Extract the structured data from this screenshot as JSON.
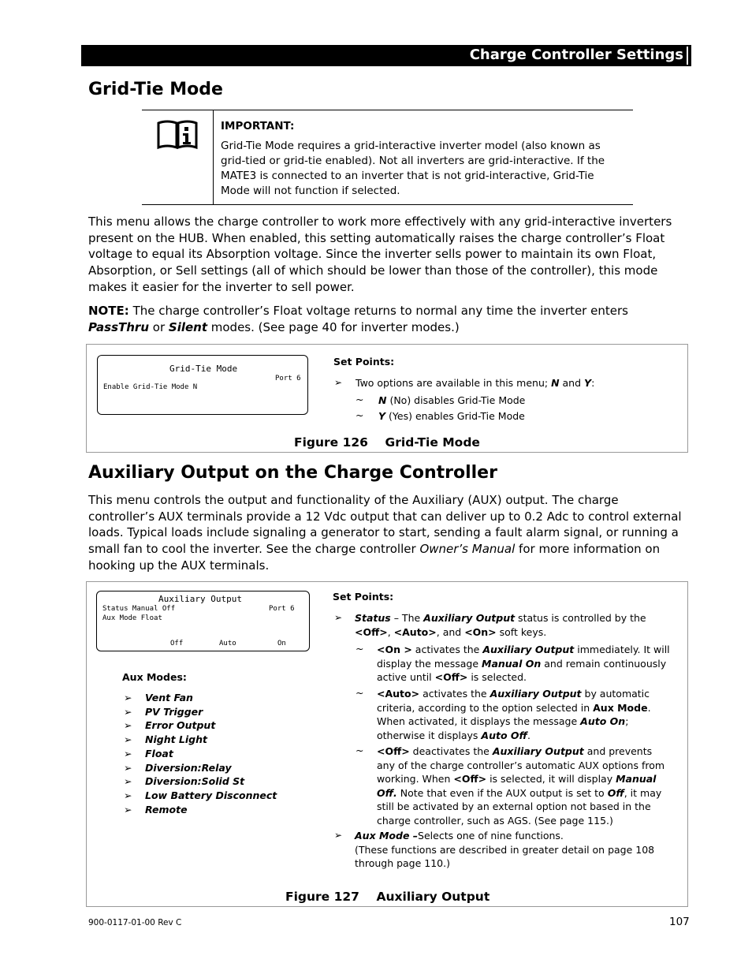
{
  "header": {
    "section_title": "Charge Controller Settings"
  },
  "gridtie": {
    "heading": "Grid-Tie Mode",
    "important": {
      "icon": "manual-info-icon",
      "title": "IMPORTANT:",
      "text": "Grid-Tie Mode requires a grid-interactive inverter model (also known as grid-tied or grid-tie enabled).  Not all inverters are grid-interactive.  If the MATE3 is connected to an inverter that is not grid-interactive, Grid-Tie Mode will not function if selected."
    },
    "body": "This menu allows the charge controller to work more effectively with any grid-interactive inverters present on the HUB.  When enabled, this setting automatically raises the charge controller’s Float voltage to equal its Absorption voltage.  Since the inverter sells power to maintain its own Float, Absorption, or Sell settings (all of which should be lower than those of the controller), this mode makes it easier for the inverter to sell power.",
    "note_label": "NOTE:",
    "note_text_1": " The charge controller’s Float voltage returns to normal any time the inverter enters ",
    "note_passthru": "PassThru",
    "note_text_2": " or ",
    "note_silent": "Silent",
    "note_text_3": " modes.  (See page 40 for inverter modes.)",
    "lcd": {
      "title": "Grid-Tie Mode",
      "port": "Port 6",
      "line1": "Enable Grid-Tie Mode N"
    },
    "setpoints": {
      "title": "Set Points:",
      "intro_1": "Two options are available in this menu; ",
      "intro_n": "N",
      "intro_2": " and ",
      "intro_y": "Y",
      "intro_3": ":",
      "options": [
        {
          "key": "N",
          "text": " (No) disables Grid-Tie Mode"
        },
        {
          "key": "Y",
          "text": " (Yes) enables Grid-Tie Mode"
        }
      ]
    },
    "caption": "Figure 126    Grid-Tie Mode"
  },
  "aux": {
    "heading": "Auxiliary Output on the Charge Controller",
    "body_1": "This menu controls the output and functionality of the Auxiliary (AUX) output.   The charge controller’s AUX terminals provide a 12 Vdc output that can deliver up to 0.2 Adc to control external loads.  Typical loads include signaling a generator to start, sending a fault alarm signal, or running a small fan to cool the inverter.  See the charge controller ",
    "body_manual": "Owner’s Manual",
    "body_2": " for more information on hooking up the AUX terminals.",
    "lcd": {
      "title": "Auxiliary Output",
      "port": "Port 6",
      "line1": "Status Manual Off",
      "line2": "Aux Mode Float",
      "softkeys": [
        "Off",
        "Auto",
        "On"
      ]
    },
    "modes_title": "Aux Modes:",
    "modes": [
      "Vent Fan",
      "PV Trigger",
      "Error Output",
      "Night Light",
      "Float",
      "Diversion:Relay",
      "Diversion:Solid St",
      "Low Battery Disconnect",
      "Remote"
    ],
    "setpoints_title": "Set Points:",
    "caption": "Figure 127    Auxiliary Output"
  },
  "footer": {
    "doc_number": "900-0117-01-00 Rev C",
    "page": "107"
  }
}
